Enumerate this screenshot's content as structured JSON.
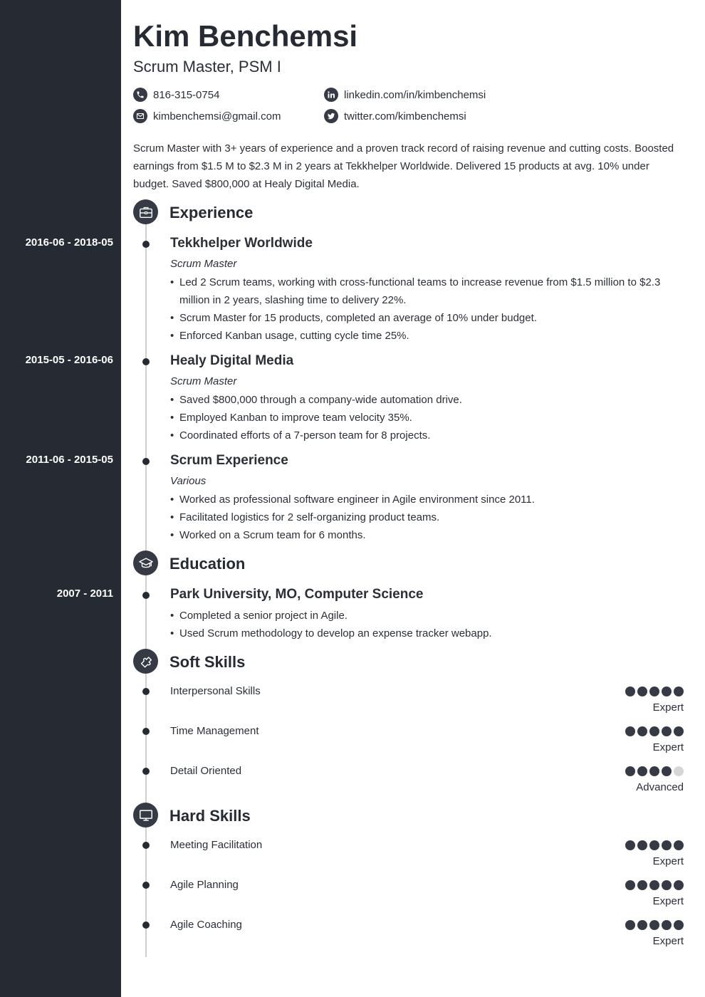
{
  "header": {
    "name": "Kim Benchemsi",
    "title": "Scrum Master, PSM I"
  },
  "contacts": {
    "phone": {
      "icon": "phone-icon",
      "value": "816-315-0754"
    },
    "email": {
      "icon": "email-icon",
      "value": "kimbenchemsi@gmail.com"
    },
    "linkedin": {
      "icon": "linkedin-icon",
      "value": "linkedin.com/in/kimbenchemsi"
    },
    "twitter": {
      "icon": "twitter-icon",
      "value": "twitter.com/kimbenchemsi"
    }
  },
  "summary": "Scrum Master with 3+ years of experience and a proven track record of raising revenue and cutting costs. Boosted earnings from $1.5 M to $2.3 M in 2 years at Tekkhelper Worldwide. Delivered 15 products at avg. 10% under budget. Saved $800,000 at Healy Digital Media.",
  "experience": {
    "heading": "Experience",
    "icon": "briefcase-icon",
    "entries": [
      {
        "dates": "2016-06 - 2018-05",
        "company": "Tekkhelper Worldwide",
        "role": "Scrum Master",
        "bullets": [
          "Led 2 Scrum teams, working with cross-functional teams to increase revenue from $1.5 million to $2.3 million in 2 years, slashing time to delivery 22%.",
          "Scrum Master for 15 products, completed an average of 10% under budget.",
          "Enforced Kanban usage, cutting cycle time 25%."
        ]
      },
      {
        "dates": "2015-05 - 2016-06",
        "company": "Healy Digital Media",
        "role": "Scrum Master",
        "bullets": [
          "Saved $800,000 through a company-wide automation drive.",
          "Employed Kanban to improve team velocity 35%.",
          "Coordinated efforts of a 7-person team for 8 projects."
        ]
      },
      {
        "dates": "2011-06 - 2015-05",
        "company": "Scrum Experience",
        "role": "Various",
        "bullets": [
          "Worked as professional software engineer in Agile environment since 2011.",
          "Facilitated logistics for 2 self-organizing product teams.",
          "Worked on a Scrum team for 6 months."
        ]
      }
    ]
  },
  "education": {
    "heading": "Education",
    "icon": "graduation-cap-icon",
    "entries": [
      {
        "dates": "2007 - 2011",
        "school": "Park University, MO, Computer Science",
        "bullets": [
          "Completed a senior project in Agile.",
          "Used Scrum methodology to develop an expense tracker webapp."
        ]
      }
    ]
  },
  "soft_skills": {
    "heading": "Soft Skills",
    "icon": "puzzle-piece-icon",
    "items": [
      {
        "name": "Interpersonal Skills",
        "rating": 5,
        "max": 5,
        "level": "Expert"
      },
      {
        "name": "Time Management",
        "rating": 5,
        "max": 5,
        "level": "Expert"
      },
      {
        "name": "Detail Oriented",
        "rating": 4,
        "max": 5,
        "level": "Advanced"
      }
    ]
  },
  "hard_skills": {
    "heading": "Hard Skills",
    "icon": "monitor-icon",
    "items": [
      {
        "name": "Meeting Facilitation",
        "rating": 5,
        "max": 5,
        "level": "Expert"
      },
      {
        "name": "Agile Planning",
        "rating": 5,
        "max": 5,
        "level": "Expert"
      },
      {
        "name": "Agile Coaching",
        "rating": 5,
        "max": 5,
        "level": "Expert"
      }
    ]
  },
  "colors": {
    "sidebar": "#252a33",
    "accent": "#353a45",
    "timeline": "#d0d0d0",
    "rating_off": "#d6d6d6"
  }
}
